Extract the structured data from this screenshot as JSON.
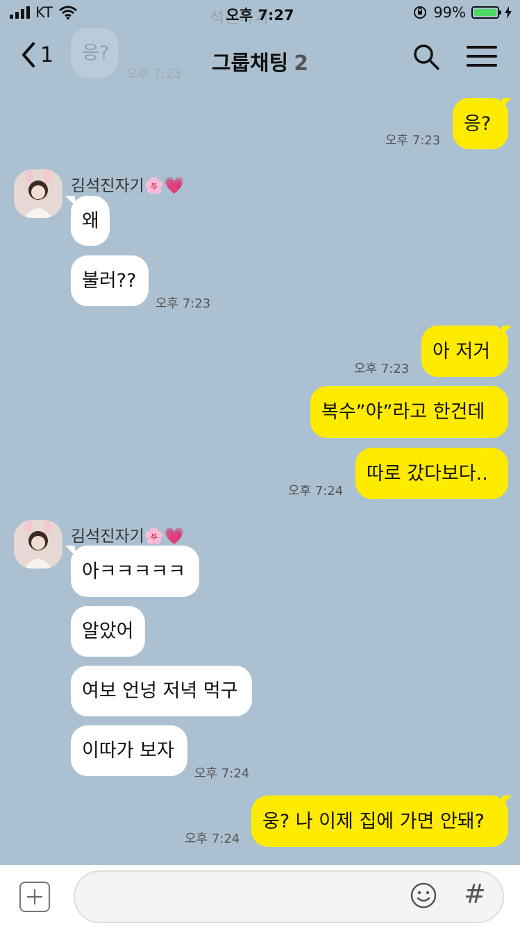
{
  "status_bar": {
    "carrier": "KT",
    "time": "오후 7:27",
    "battery": "99%",
    "battery_level": 0.99
  },
  "nav": {
    "back_count": "1",
    "title": "그룹채팅",
    "member_count": "2"
  },
  "ghost": {
    "name": "석진자기",
    "bubble": "응?",
    "time": "오후 7:23"
  },
  "messages": {
    "o1": {
      "text": "응?",
      "time": "오후 7:23"
    },
    "g1": {
      "sender": "김석진자기🌸💗"
    },
    "i1": {
      "text": "왜"
    },
    "i2": {
      "text": "불러??",
      "time": "오후 7:23"
    },
    "o2": {
      "text": "아 저거",
      "time": "오후 7:23"
    },
    "o3": {
      "text": "복수”야”라고 한건데"
    },
    "o4": {
      "text": "따로 갔다보다..",
      "time": "오후 7:24"
    },
    "g2": {
      "sender": "김석진자기🌸💗"
    },
    "i3": {
      "text": "아ㅋㅋㅋㅋㅋ"
    },
    "i4": {
      "text": "알았어"
    },
    "i5": {
      "text": "여보 언넝 저녁 먹구"
    },
    "i6": {
      "text": "이따가 보자",
      "time": "오후 7:24"
    },
    "o5": {
      "text": "웅? 나 이제 집에 가면 안돼?",
      "time": "오후 7:24"
    }
  },
  "input_bar": {
    "placeholder": "",
    "hash": "#"
  },
  "colors": {
    "background": "#abc1d1",
    "my_bubble": "#ffeb00",
    "their_bubble": "#ffffff"
  }
}
